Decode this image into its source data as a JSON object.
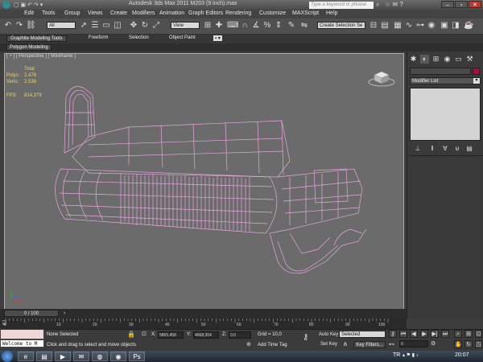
{
  "window": {
    "title": "Autodesk 3ds Max  2011      M203 (9 inch).max",
    "search_placeholder": "Type a keyword or phrase"
  },
  "menu": [
    "Edit",
    "Tools",
    "Group",
    "Views",
    "Create",
    "Modifiers",
    "Animation",
    "Graph Editors",
    "Rendering",
    "Customize",
    "MAXScript",
    "Help"
  ],
  "toolbar": {
    "selection_filter": "All",
    "ref_coord": "View",
    "selection_set": "Create Selection Se"
  },
  "ribbon": {
    "tabs": [
      "Graphite Modeling Tools",
      "Freeform",
      "Selection",
      "Object Paint"
    ],
    "sub_label": "Polygon Modeling"
  },
  "viewport": {
    "label": "[ + ] [ Perspective ] [ Wireframe ]",
    "stats": {
      "total_label": "Total",
      "polys_label": "Polys:",
      "polys_value": "2,478",
      "verts_label": "Verts:",
      "verts_value": "2,538",
      "fps_label": "FPS:",
      "fps_value": "814,379"
    }
  },
  "command_panel": {
    "modifier_list": "Modifier List"
  },
  "timeline": {
    "slider": "0 / 100",
    "ticks": [
      "0",
      "10",
      "20",
      "30",
      "40",
      "50",
      "60",
      "70",
      "80",
      "90",
      "100"
    ]
  },
  "status": {
    "maxscript_prompt": "Welcome to M",
    "selection": "None Selected",
    "prompt": "Click and drag to select and move objects",
    "x_label": "X:",
    "x_value": "5865,458",
    "y_label": "Y:",
    "y_value": "4668,304",
    "z_label": "Z:",
    "z_value": "0,0",
    "grid": "Grid = 10,0",
    "add_time_tag": "Add Time Tag",
    "auto_key": "Auto Key",
    "selected_dropdown": "Selected",
    "set_key": "Set Key",
    "key_filters": "Key Filters...",
    "frame_value": "0"
  },
  "taskbar": {
    "lang": "TR",
    "time": "20:07"
  },
  "colors": {
    "wireframe": "#e7a6e0",
    "object_color": "#a3103f",
    "viewport_bg": "#6b6b6b"
  }
}
